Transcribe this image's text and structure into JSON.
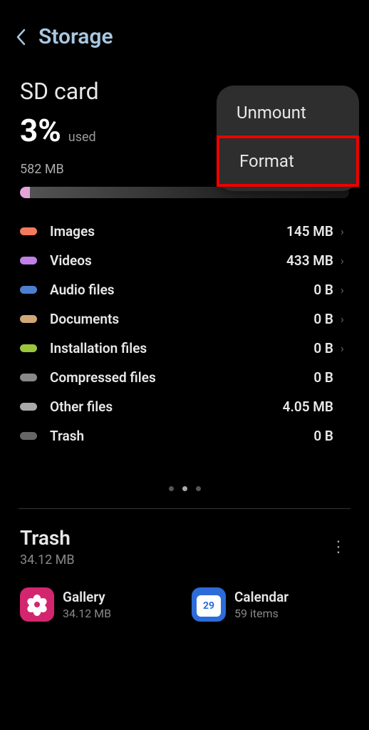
{
  "header": {
    "title": "Storage"
  },
  "sd": {
    "title": "SD card",
    "percent": "3%",
    "used_label": "used",
    "total": "582 MB"
  },
  "categories": [
    {
      "label": "Images",
      "value": "145 MB",
      "color": "#f47a5c",
      "chevron": true
    },
    {
      "label": "Videos",
      "value": "433 MB",
      "color": "#c080e8",
      "chevron": true
    },
    {
      "label": "Audio files",
      "value": "0 B",
      "color": "#4d7fd0",
      "chevron": true
    },
    {
      "label": "Documents",
      "value": "0 B",
      "color": "#d0a878",
      "chevron": true
    },
    {
      "label": "Installation files",
      "value": "0 B",
      "color": "#9bc53d",
      "chevron": true
    },
    {
      "label": "Compressed files",
      "value": "0 B",
      "color": "#888",
      "chevron": false
    },
    {
      "label": "Other files",
      "value": "4.05 MB",
      "color": "#aaa",
      "chevron": false
    },
    {
      "label": "Trash",
      "value": "0 B",
      "color": "#666",
      "chevron": false
    }
  ],
  "trash": {
    "title": "Trash",
    "size": "34.12 MB",
    "apps": [
      {
        "name": "Gallery",
        "sub": "34.12 MB"
      },
      {
        "name": "Calendar",
        "sub": "59 items",
        "day": "29"
      }
    ]
  },
  "popup": {
    "unmount": "Unmount",
    "format": "Format"
  }
}
